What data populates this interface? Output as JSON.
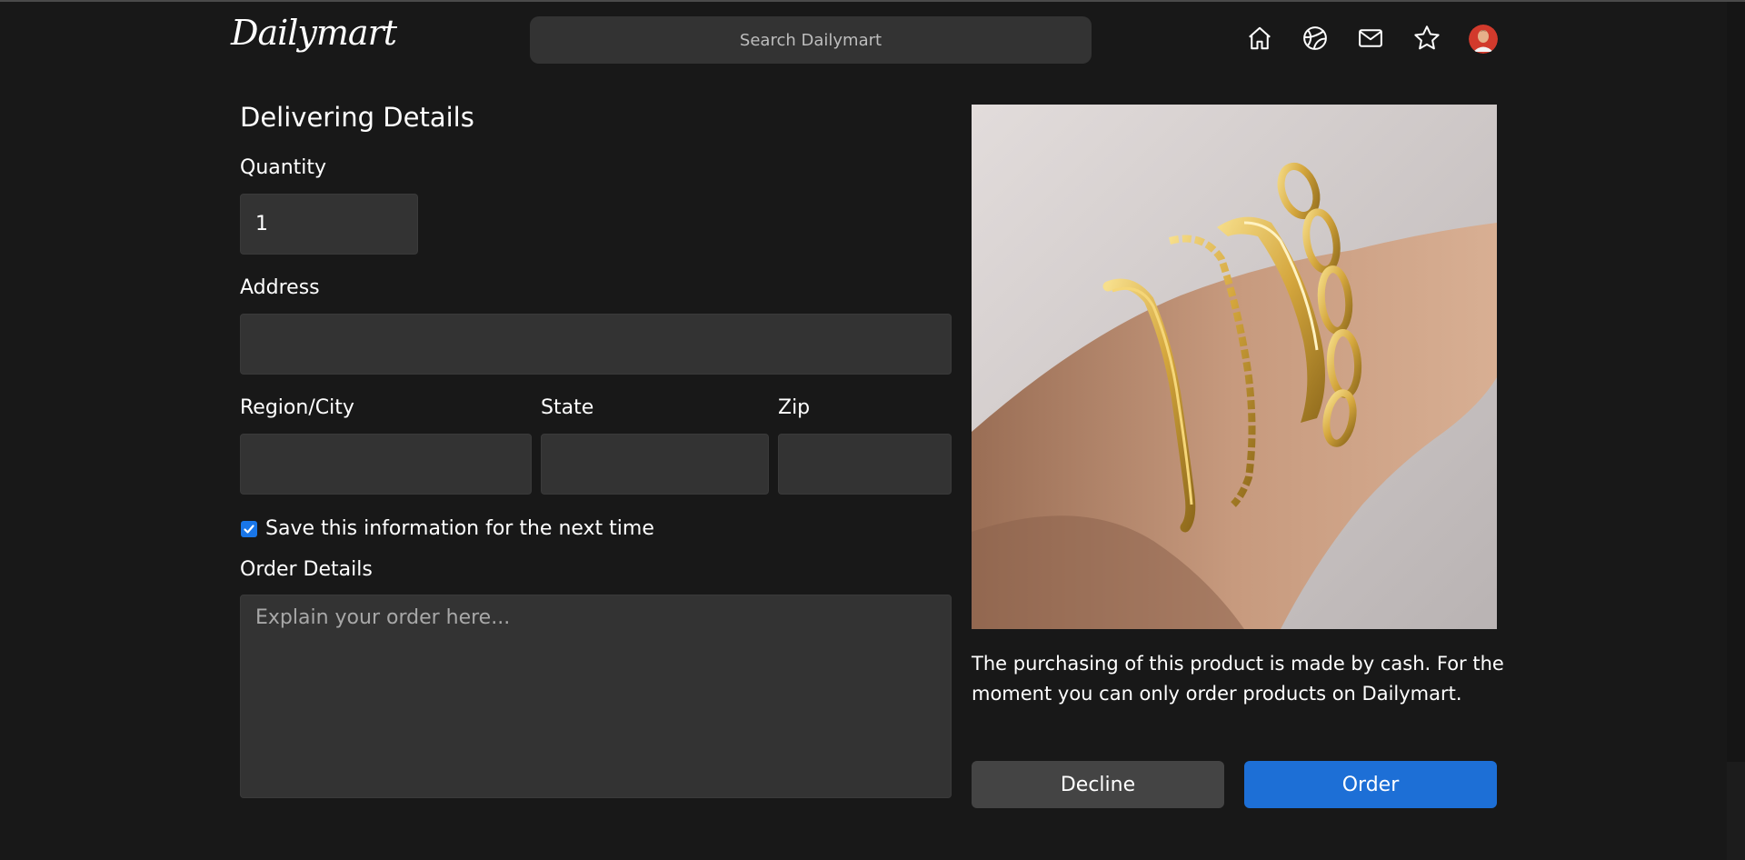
{
  "app": {
    "logo_text": "Dailymart"
  },
  "header": {
    "search_placeholder": "Search Dailymart",
    "nav_icons": [
      "home-icon",
      "globe-icon",
      "mail-icon",
      "star-icon",
      "avatar"
    ]
  },
  "form": {
    "title": "Delivering Details",
    "quantity_label": "Quantity",
    "quantity_value": "1",
    "address_label": "Address",
    "address_value": "",
    "region_label": "Region/City",
    "region_value": "",
    "state_label": "State",
    "state_value": "",
    "zip_label": "Zip",
    "zip_value": "",
    "save_checkbox_label": "Save this information for the next time",
    "save_checked": true,
    "order_details_label": "Order Details",
    "order_details_placeholder": "Explain your order here..."
  },
  "product": {
    "info_text": "The purchasing of this product is made by cash. For the moment you can only order products on Dailymart."
  },
  "actions": {
    "decline_label": "Decline",
    "order_label": "Order"
  },
  "colors": {
    "background": "#181818",
    "field_bg": "#333333",
    "accent": "#1d6fd6",
    "secondary_button": "#444444"
  }
}
